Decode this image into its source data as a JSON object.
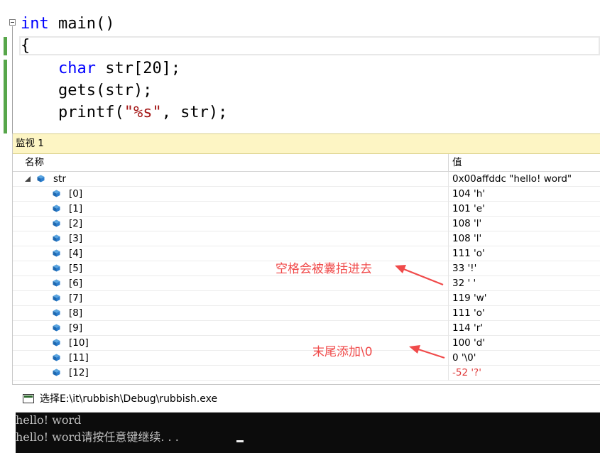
{
  "editor": {
    "lines": [
      {
        "parts": [
          {
            "t": "int",
            "c": "kw"
          },
          {
            "t": " main()",
            "c": ""
          }
        ]
      },
      {
        "parts": [
          {
            "t": "{",
            "c": ""
          }
        ]
      },
      {
        "parts": [
          {
            "t": "    ",
            "c": ""
          },
          {
            "t": "char",
            "c": "kw"
          },
          {
            "t": " str[20];",
            "c": ""
          }
        ]
      },
      {
        "parts": [
          {
            "t": "    gets(str);",
            "c": ""
          }
        ]
      },
      {
        "parts": [
          {
            "t": "    printf(",
            "c": ""
          },
          {
            "t": "\"%s\"",
            "c": "str"
          },
          {
            "t": ", str);",
            "c": ""
          }
        ]
      }
    ]
  },
  "watch": {
    "title": "监视 1",
    "col_name": "名称",
    "col_value": "值",
    "root": {
      "name": "str",
      "value": "0x00affddc \"hello! word\""
    },
    "items": [
      {
        "name": "[0]",
        "value": "104 'h'"
      },
      {
        "name": "[1]",
        "value": "101 'e'"
      },
      {
        "name": "[2]",
        "value": "108 'l'"
      },
      {
        "name": "[3]",
        "value": "108 'l'"
      },
      {
        "name": "[4]",
        "value": "111 'o'"
      },
      {
        "name": "[5]",
        "value": "33 '!'"
      },
      {
        "name": "[6]",
        "value": "32 ' '"
      },
      {
        "name": "[7]",
        "value": "119 'w'"
      },
      {
        "name": "[8]",
        "value": "111 'o'"
      },
      {
        "name": "[9]",
        "value": "114 'r'"
      },
      {
        "name": "[10]",
        "value": "100 'd'"
      },
      {
        "name": "[11]",
        "value": "0 '\\0'"
      },
      {
        "name": "[12]",
        "value": "-52 '?'",
        "changed": true
      }
    ],
    "annotations": {
      "space": "空格会被囊括进去",
      "terminator": "末尾添加\\0"
    }
  },
  "console": {
    "title": "选择E:\\it\\rubbish\\Debug\\rubbish.exe",
    "lines": [
      "hello! word",
      "hello! word请按任意键继续. . . "
    ]
  }
}
